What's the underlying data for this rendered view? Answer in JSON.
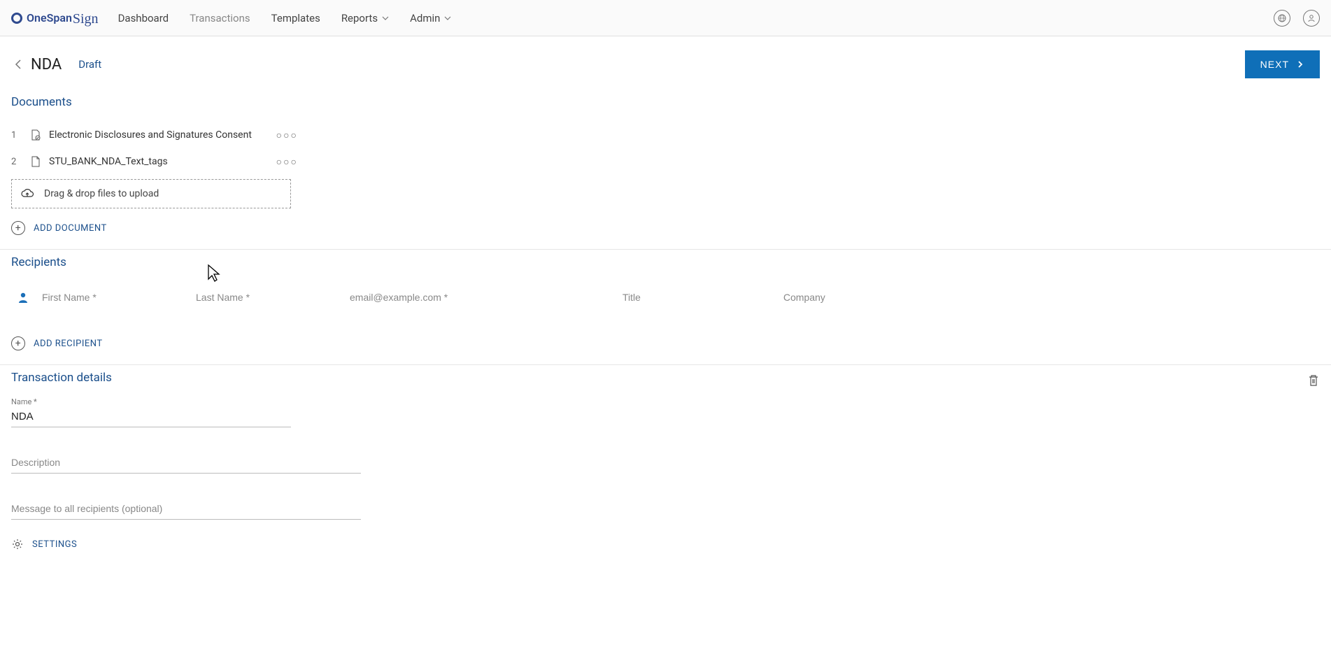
{
  "brand": {
    "name": "OneSpan",
    "suffix": "Sign"
  },
  "nav": {
    "dashboard": "Dashboard",
    "transactions": "Transactions",
    "templates": "Templates",
    "reports": "Reports",
    "admin": "Admin"
  },
  "header": {
    "title": "NDA",
    "status": "Draft",
    "next": "NEXT"
  },
  "documents": {
    "title": "Documents",
    "items": [
      {
        "index": "1",
        "name": "Electronic Disclosures and Signatures Consent"
      },
      {
        "index": "2",
        "name": "STU_BANK_NDA_Text_tags"
      }
    ],
    "dropzone": "Drag & drop files to upload",
    "add": "ADD DOCUMENT"
  },
  "recipients": {
    "title": "Recipients",
    "first_name_ph": "First Name *",
    "last_name_ph": "Last Name *",
    "email_ph": "email@example.com *",
    "title_ph": "Title",
    "company_ph": "Company",
    "add": "ADD RECIPIENT"
  },
  "details": {
    "title": "Transaction details",
    "name_label": "Name *",
    "name_value": "NDA",
    "description_ph": "Description",
    "message_ph": "Message to all recipients (optional)",
    "settings": "SETTINGS"
  }
}
